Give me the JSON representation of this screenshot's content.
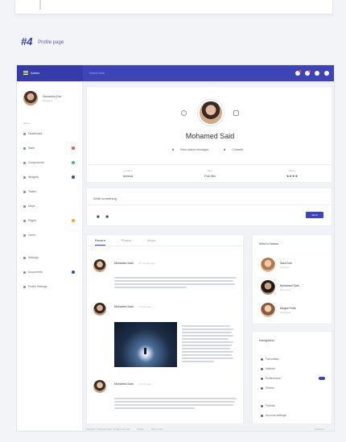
{
  "section": {
    "number": "#4",
    "title": "Profile page"
  },
  "topbar": {
    "brand": "Admin",
    "search_placeholder": "Search here"
  },
  "sidebar": {
    "user": {
      "name": "Samantha Doe",
      "role": "Designer"
    },
    "menu_heading": "Menu",
    "items": [
      {
        "label": "Dashboard",
        "badge": null
      },
      {
        "label": "Stats",
        "badge": "#e8534f"
      },
      {
        "label": "Components",
        "badge": "#3fbf6f"
      },
      {
        "label": "Widgets",
        "badge": "#3d44b5"
      },
      {
        "label": "Tables",
        "badge": null
      },
      {
        "label": "Maps",
        "badge": null
      },
      {
        "label": "Pages",
        "badge": "#f5a623"
      },
      {
        "label": "Users",
        "badge": null
      },
      {
        "label": "Settings",
        "badge": null
      },
      {
        "label": "Documents",
        "badge": "#3d44b5"
      },
      {
        "label": "Profile Settings",
        "badge": null
      }
    ]
  },
  "profile": {
    "name": "Mohamed Said",
    "link1": "Send status messages",
    "link2": "Contacts",
    "stats": [
      {
        "label": "Location",
        "value": "Ireland"
      },
      {
        "label": "Date",
        "value": "Feb 8th"
      },
      {
        "label": "Rating",
        "value": "★★★★"
      }
    ]
  },
  "composer": {
    "title": "Write something",
    "tools": "■ ■",
    "send_label": "Send"
  },
  "feed": {
    "tabs": [
      "Recent",
      "Photos",
      "Music"
    ],
    "posts": [
      {
        "name": "Mohamed Said",
        "time": "20 minutes ago"
      },
      {
        "name": "Mohamed Said",
        "time": "2 hours ago"
      },
      {
        "name": "Mohamed Said",
        "time": "5 hours ago"
      }
    ]
  },
  "who_to_follow": {
    "title": "Who to follow",
    "people": [
      {
        "name": "Sara Doe",
        "role": "Designer"
      },
      {
        "name": "Mohamed Said",
        "role": "Developer"
      },
      {
        "name": "Megan Potts",
        "role": "Marketing"
      }
    ]
  },
  "navigation": {
    "title": "Navigation",
    "items": [
      "Favourites",
      "Notices",
      "Preferences",
      "Photos",
      "Friends",
      "Account settings"
    ]
  },
  "footer": {
    "left": [
      "Copyright © Mohamed Said. All rights reserved.",
      "Privacy",
      "Terms of Use"
    ],
    "right": "Contact us"
  }
}
